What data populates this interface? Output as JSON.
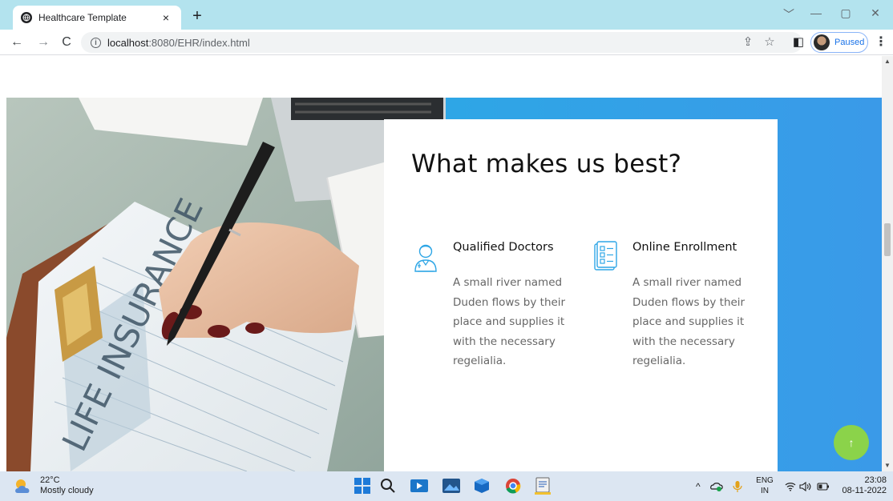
{
  "browser": {
    "tab_title": "Healthcare Template",
    "tab_close": "×",
    "new_tab": "+",
    "url_host": "localhost",
    "url_rest": ":8080/EHR/index.html",
    "profile_status": "Paused",
    "window_controls": [
      "﹀",
      "—",
      "▢",
      "✕"
    ],
    "icons": [
      "back-icon",
      "forward-icon",
      "reload-icon",
      "info-icon",
      "share-icon",
      "star-icon",
      "side-panel-icon",
      "menu-icon"
    ]
  },
  "page": {
    "section_title": "What makes us best?",
    "features": [
      {
        "title": "Qualified Doctors",
        "text": "A small river named Duden flows by their place and supplies it with the necessary regelialia.",
        "icon": "doctor-icon"
      },
      {
        "title": "Online Enrollment",
        "text": "A small river named Duden flows by their place and supplies it with the necessary regelialia.",
        "icon": "form-icon"
      }
    ],
    "image_text": "LIFE INSURANCE",
    "scroll_top_label": "↑",
    "colors": {
      "accent_blue": "#2ea6e6",
      "scroll_button": "#8bd34a",
      "icon_teal": "#2ea6e6"
    }
  },
  "taskbar": {
    "temperature": "22°C",
    "weather": "Mostly cloudy",
    "language_top": "ENG",
    "language_bottom": "IN",
    "time": "23:08",
    "date": "08-11-2022",
    "tray_chevron": "^"
  }
}
